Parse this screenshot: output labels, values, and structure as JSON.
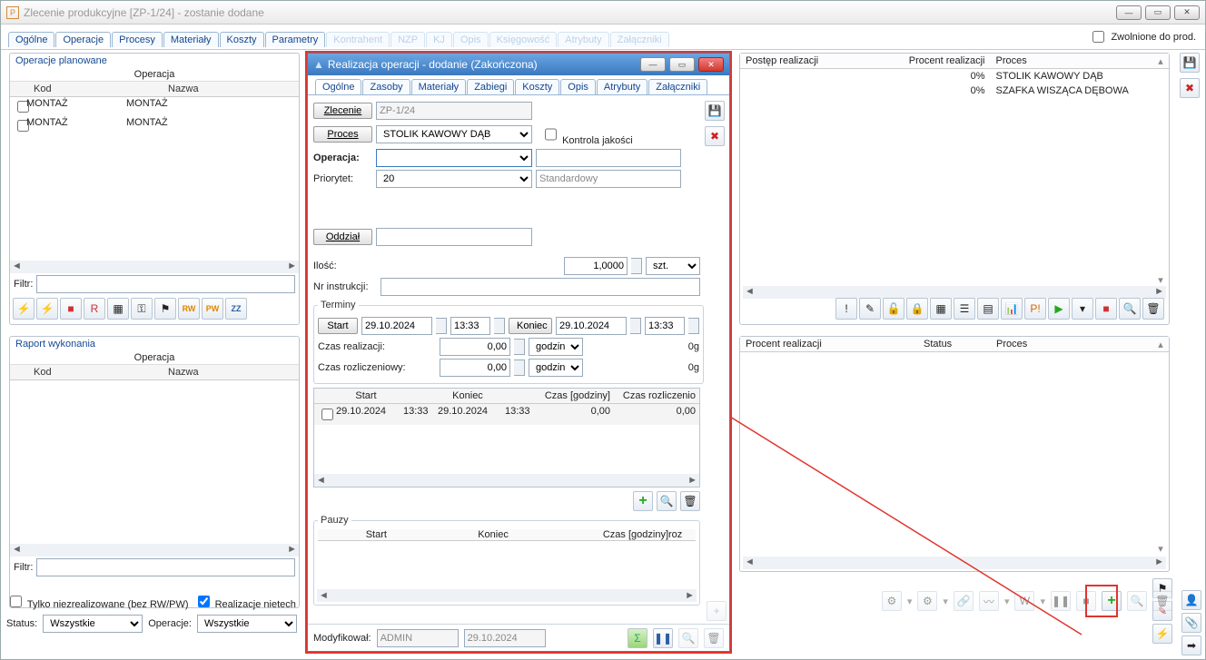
{
  "window": {
    "title": "Zlecenie produkcyjne  [ZP-1/24] - zostanie dodane"
  },
  "main_tabs": [
    "Ogólne",
    "Operacje",
    "Procesy",
    "Materiały",
    "Koszty",
    "Parametry",
    "Kontrahent",
    "NZP",
    "KJ",
    "Opis",
    "Księgowość",
    "Atrybuty",
    "Załączniki"
  ],
  "main_active_tab": 1,
  "released_checkbox": "Zwolnione do prod.",
  "planned": {
    "title": "Operacje planowane",
    "group": "Operacja",
    "cols": [
      "Kod",
      "Nazwa"
    ],
    "rows": [
      [
        "MONTAŻ",
        "MONTAŻ"
      ],
      [
        "MONTAŻ",
        "MONTAŻ"
      ]
    ],
    "filtr_label": "Filtr:",
    "icons": [
      "flash",
      "flash-green",
      "stop",
      "R-red",
      "grid",
      "key",
      "flag",
      "RW",
      "PW",
      "ZZ"
    ]
  },
  "raport": {
    "title": "Raport wykonania",
    "group": "Operacja",
    "cols": [
      "Kod",
      "Nazwa"
    ],
    "filtr_label": "Filtr:",
    "opt1": "Tylko niezrealizowane (bez RW/PW)",
    "opt2": "Realizacje nietech"
  },
  "progress_top": {
    "cols": [
      "Postęp realizacji",
      "Procent realizacji",
      "Proces"
    ],
    "rows": [
      [
        "",
        "0%",
        "STOLIK KAWOWY DĄB"
      ],
      [
        "",
        "0%",
        "SZAFKA WISZĄCA DĘBOWA"
      ]
    ]
  },
  "progress_bottom": {
    "cols": [
      "Procent realizacji",
      "Status",
      "Proces"
    ]
  },
  "bottom": {
    "status_label": "Status:",
    "status_value": "Wszystkie",
    "oper_label": "Operacje:",
    "oper_value": "Wszystkie"
  },
  "modal": {
    "title": "Realizacja operacji - dodanie (Zakończona)",
    "tabs": [
      "Ogólne",
      "Zasoby",
      "Materiały",
      "Zabiegi",
      "Koszty",
      "Opis",
      "Atrybuty",
      "Załączniki"
    ],
    "active_tab": 0,
    "zlecenie_btn": "Zlecenie",
    "zlecenie_val": "ZP-1/24",
    "proces_btn": "Proces",
    "proces_val": "STOLIK KAWOWY DĄB",
    "kontrola": "Kontrola jakości",
    "operacja_lbl": "Operacja:",
    "operacja_val": "",
    "priorytet_lbl": "Priorytet:",
    "priorytet_val": "20",
    "priorytet_name": "Standardowy",
    "oddzial_btn": "Oddział",
    "oddzial_val": "",
    "ilosc_lbl": "Ilość:",
    "ilosc_val": "1,0000",
    "ilosc_unit": "szt.",
    "nrinstr_lbl": "Nr instrukcji:",
    "nrinstr_val": "",
    "terminy": "Terminy",
    "start_btn": "Start",
    "start_date": "29.10.2024",
    "start_time": "13:33",
    "koniec_btn": "Koniec",
    "koniec_date": "29.10.2024",
    "koniec_time": "13:33",
    "czas_real_lbl": "Czas realizacji:",
    "czas_real_val": "0,00",
    "czas_rozl_lbl": "Czas rozliczeniowy:",
    "czas_rozl_val": "0,00",
    "godzin": "godzin",
    "zero_g": "0g",
    "tg_cols": [
      "Start",
      "",
      "Koniec",
      "",
      "Czas [godziny]",
      "Czas rozliczenio"
    ],
    "tg_row": [
      "29.10.2024",
      "13:33",
      "29.10.2024",
      "13:33",
      "0,00",
      "0,00"
    ],
    "pauzy": "Pauzy",
    "pz_cols": [
      "Start",
      "Koniec",
      "Czas [godziny]",
      "roz"
    ],
    "mod_lbl": "Modyfikował:",
    "mod_user": "ADMIN",
    "mod_date": "29.10.2024"
  }
}
